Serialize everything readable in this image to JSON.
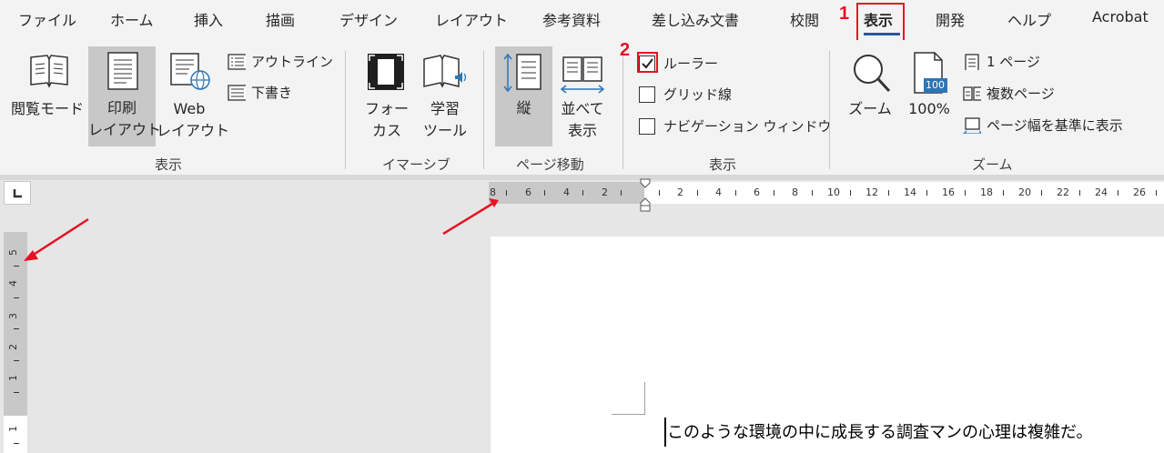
{
  "tabs": [
    "ファイル",
    "ホーム",
    "挿入",
    "描画",
    "デザイン",
    "レイアウト",
    "参考資料",
    "差し込み文書",
    "校閲",
    "表示",
    "開発",
    "ヘルプ",
    "Acrobat"
  ],
  "active_tab": "表示",
  "annotations": {
    "step1": "1",
    "step2": "2"
  },
  "groups": {
    "views": {
      "label": "表示",
      "read_mode": "閲覧モード",
      "print_layout_1": "印刷",
      "print_layout_2": "レイアウト",
      "web_layout_1": "Web",
      "web_layout_2": "レイアウト",
      "outline": "アウトライン",
      "draft": "下書き"
    },
    "immersive": {
      "label": "イマーシブ",
      "focus_1": "フォー",
      "focus_2": "カス",
      "learning_1": "学習",
      "learning_2": "ツール"
    },
    "page_movement": {
      "label": "ページ移動",
      "vertical": "縦",
      "side_1": "並べて",
      "side_2": "表示"
    },
    "show": {
      "label": "表示",
      "ruler": "ルーラー",
      "ruler_checked": true,
      "gridlines": "グリッド線",
      "nav_pane": "ナビゲーション ウィンドウ"
    },
    "zoom": {
      "label": "ズーム",
      "zoom": "ズーム",
      "hundred": "100%",
      "one_page": "1 ページ",
      "multi_page": "複数ページ",
      "page_width": "ページ幅を基準に表示",
      "icon_badge": "100"
    }
  },
  "hruler_numbers": [
    "8",
    "6",
    "4",
    "2",
    "2",
    "4",
    "6",
    "8",
    "10",
    "12",
    "14",
    "16",
    "18",
    "20",
    "22",
    "24",
    "26"
  ],
  "vruler_numbers": [
    "5",
    "4",
    "3",
    "2",
    "1",
    "1"
  ],
  "document": {
    "text": "このような環境の中に成長する調査マンの心理は複雑だ。"
  },
  "colors": {
    "accent": "#2b579a",
    "annotation": "#e81123",
    "icon_blue": "#2e75b6"
  }
}
